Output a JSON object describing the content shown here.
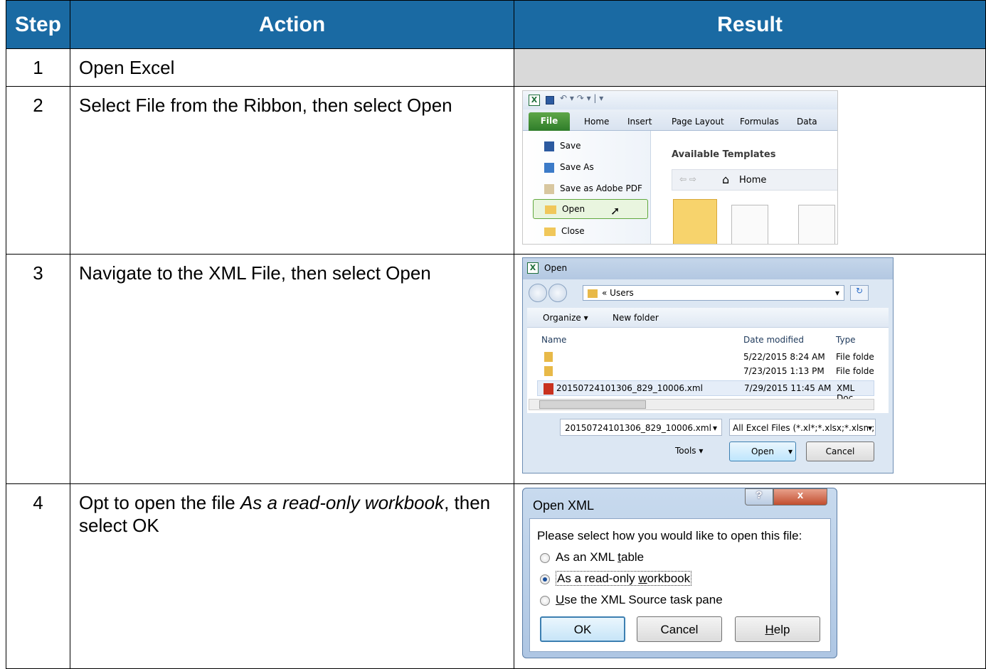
{
  "header": {
    "step": "Step",
    "action": "Action",
    "result": "Result"
  },
  "rows": [
    {
      "step": "1",
      "action": "Open Excel"
    },
    {
      "step": "2",
      "action": "Select File from the Ribbon, then select Open"
    },
    {
      "step": "3",
      "action": "Navigate to the XML File, then select Open"
    },
    {
      "step": "4",
      "action_prefix": "Opt to open the file ",
      "action_italic": "As a read-only workbook",
      "action_suffix": ", then select OK"
    }
  ],
  "excel_file": {
    "tabs": [
      "File",
      "Home",
      "Insert",
      "Page Layout",
      "Formulas",
      "Data"
    ],
    "menu": [
      "Save",
      "Save As",
      "Save as Adobe PDF",
      "Open",
      "Close"
    ],
    "templates_title": "Available Templates",
    "nav_home": "Home"
  },
  "open_dialog": {
    "title": "Open",
    "path_sep": "«",
    "path": "Users",
    "organize": "Organize ▾",
    "new_folder": "New folder",
    "columns": [
      "Name",
      "Date modified",
      "Type"
    ],
    "files": [
      {
        "name": "",
        "date": "5/22/2015 8:24 AM",
        "type": "File folde"
      },
      {
        "name": "",
        "date": "7/23/2015 1:13 PM",
        "type": "File folde"
      },
      {
        "name": "20150724101306_829_10006.xml",
        "date": "7/29/2015 11:45 AM",
        "type": "XML Doc"
      }
    ],
    "filename": "20150724101306_829_10006.xml",
    "filter": "All Excel Files (*.xl*;*.xlsx;*.xlsm;",
    "tools": "Tools",
    "open_btn": "Open",
    "cancel_btn": "Cancel"
  },
  "open_xml": {
    "title": "Open XML",
    "help_glyph": "?",
    "close_glyph": "x",
    "prompt": "Please select how you would like to open this file:",
    "opt1_a": "As an XML ",
    "opt1_u": "t",
    "opt1_b": "able",
    "opt2_a": "As a read-only ",
    "opt2_u": "w",
    "opt2_b": "orkbook",
    "opt3_u": "U",
    "opt3_b": "se the XML Source task pane",
    "ok": "OK",
    "cancel": "Cancel",
    "help_u": "H",
    "help_b": "elp"
  }
}
